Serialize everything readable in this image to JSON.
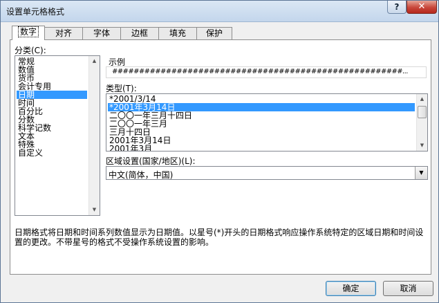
{
  "window": {
    "title": "设置单元格格式",
    "help_label": "?",
    "close_label": "✕"
  },
  "tabs": [
    {
      "label": "数字",
      "active": true
    },
    {
      "label": "对齐"
    },
    {
      "label": "字体"
    },
    {
      "label": "边框"
    },
    {
      "label": "填充"
    },
    {
      "label": "保护"
    }
  ],
  "category": {
    "label": "分类(C):",
    "items": [
      "常规",
      "数值",
      "货币",
      "会计专用",
      "日期",
      "时间",
      "百分比",
      "分数",
      "科学记数",
      "文本",
      "特殊",
      "自定义"
    ],
    "selected": "日期"
  },
  "sample": {
    "label": "示例",
    "value": "######################################################..."
  },
  "type": {
    "label": "类型(T):",
    "items": [
      "*2001/3/14",
      "*2001年3月14日",
      "二〇〇一年三月十四日",
      "二〇〇一年三月",
      "三月十四日",
      "2001年3月14日",
      "2001年3月"
    ],
    "selected": "*2001年3月14日"
  },
  "locale": {
    "label": "区域设置(国家/地区)(L):",
    "value": "中文(简体，中国)"
  },
  "description": "日期格式将日期和时间系列数值显示为日期值。以星号(*)开头的日期格式响应操作系统特定的区域日期和时间设置的更改。不带星号的格式不受操作系统设置的影响。",
  "buttons": {
    "ok": "确定",
    "cancel": "取消"
  }
}
